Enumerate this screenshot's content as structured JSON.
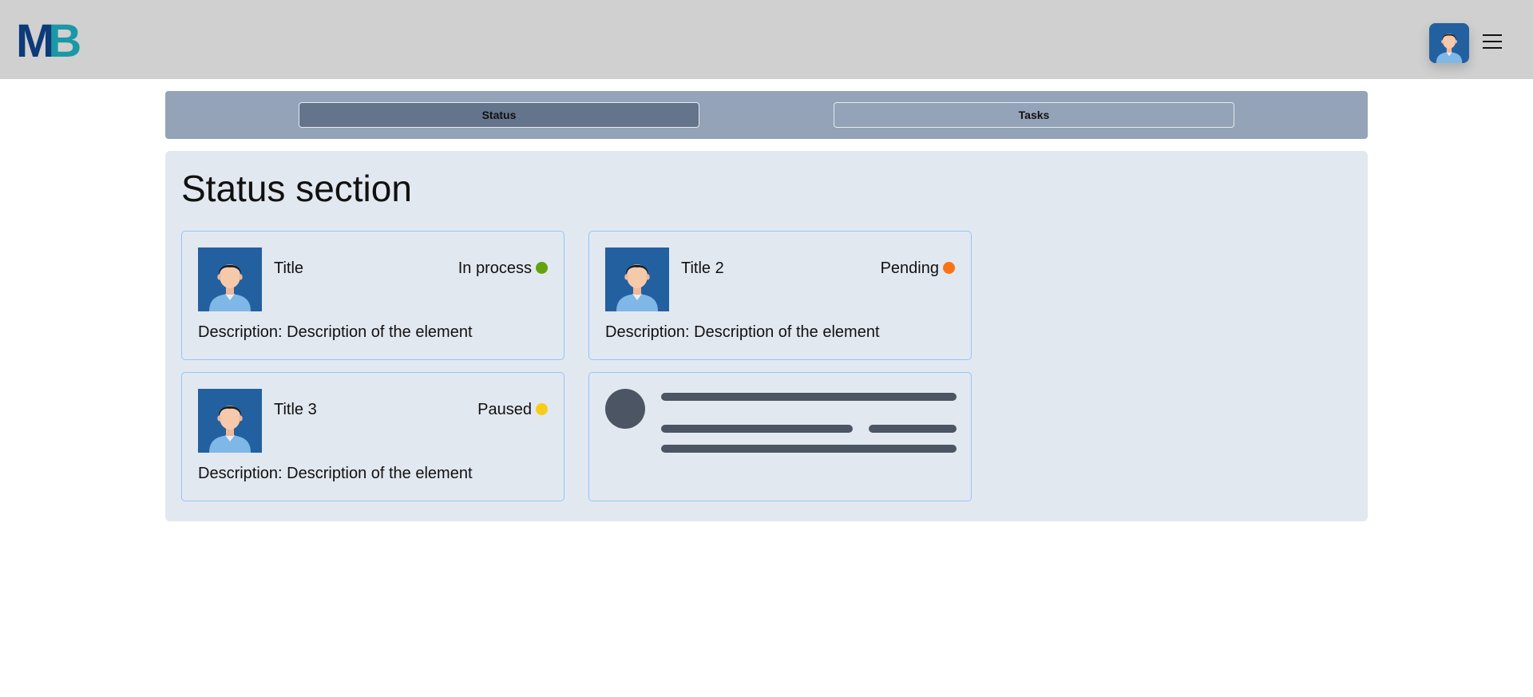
{
  "header": {
    "logo_text": "MB",
    "logo_colors": {
      "m": "#0d3a78",
      "b": "#1a98a6"
    },
    "avatar_icon": "user-avatar-icon",
    "menu_icon": "hamburger-menu-icon"
  },
  "tabs": [
    {
      "label": "Status",
      "active": true
    },
    {
      "label": "Tasks",
      "active": false
    }
  ],
  "section": {
    "title": "Status section"
  },
  "cards": [
    {
      "title": "Title",
      "status": "In process",
      "status_color": "#65a30d",
      "description": "Description: Description of the element"
    },
    {
      "title": "Title 2",
      "status": "Pending",
      "status_color": "#f97316",
      "description": "Description: Description of the element"
    },
    {
      "title": "Title 3",
      "status": "Paused",
      "status_color": "#facc15",
      "description": "Description: Description of the element"
    }
  ],
  "colors": {
    "topbar": "#d0d0d0",
    "tabbar": "#94a3b8",
    "tab_active": "#64748b",
    "panel": "#e2e8f0",
    "card_border": "#93c5fd",
    "skeleton": "#4b5563",
    "avatar_bg": "#2360a0"
  }
}
